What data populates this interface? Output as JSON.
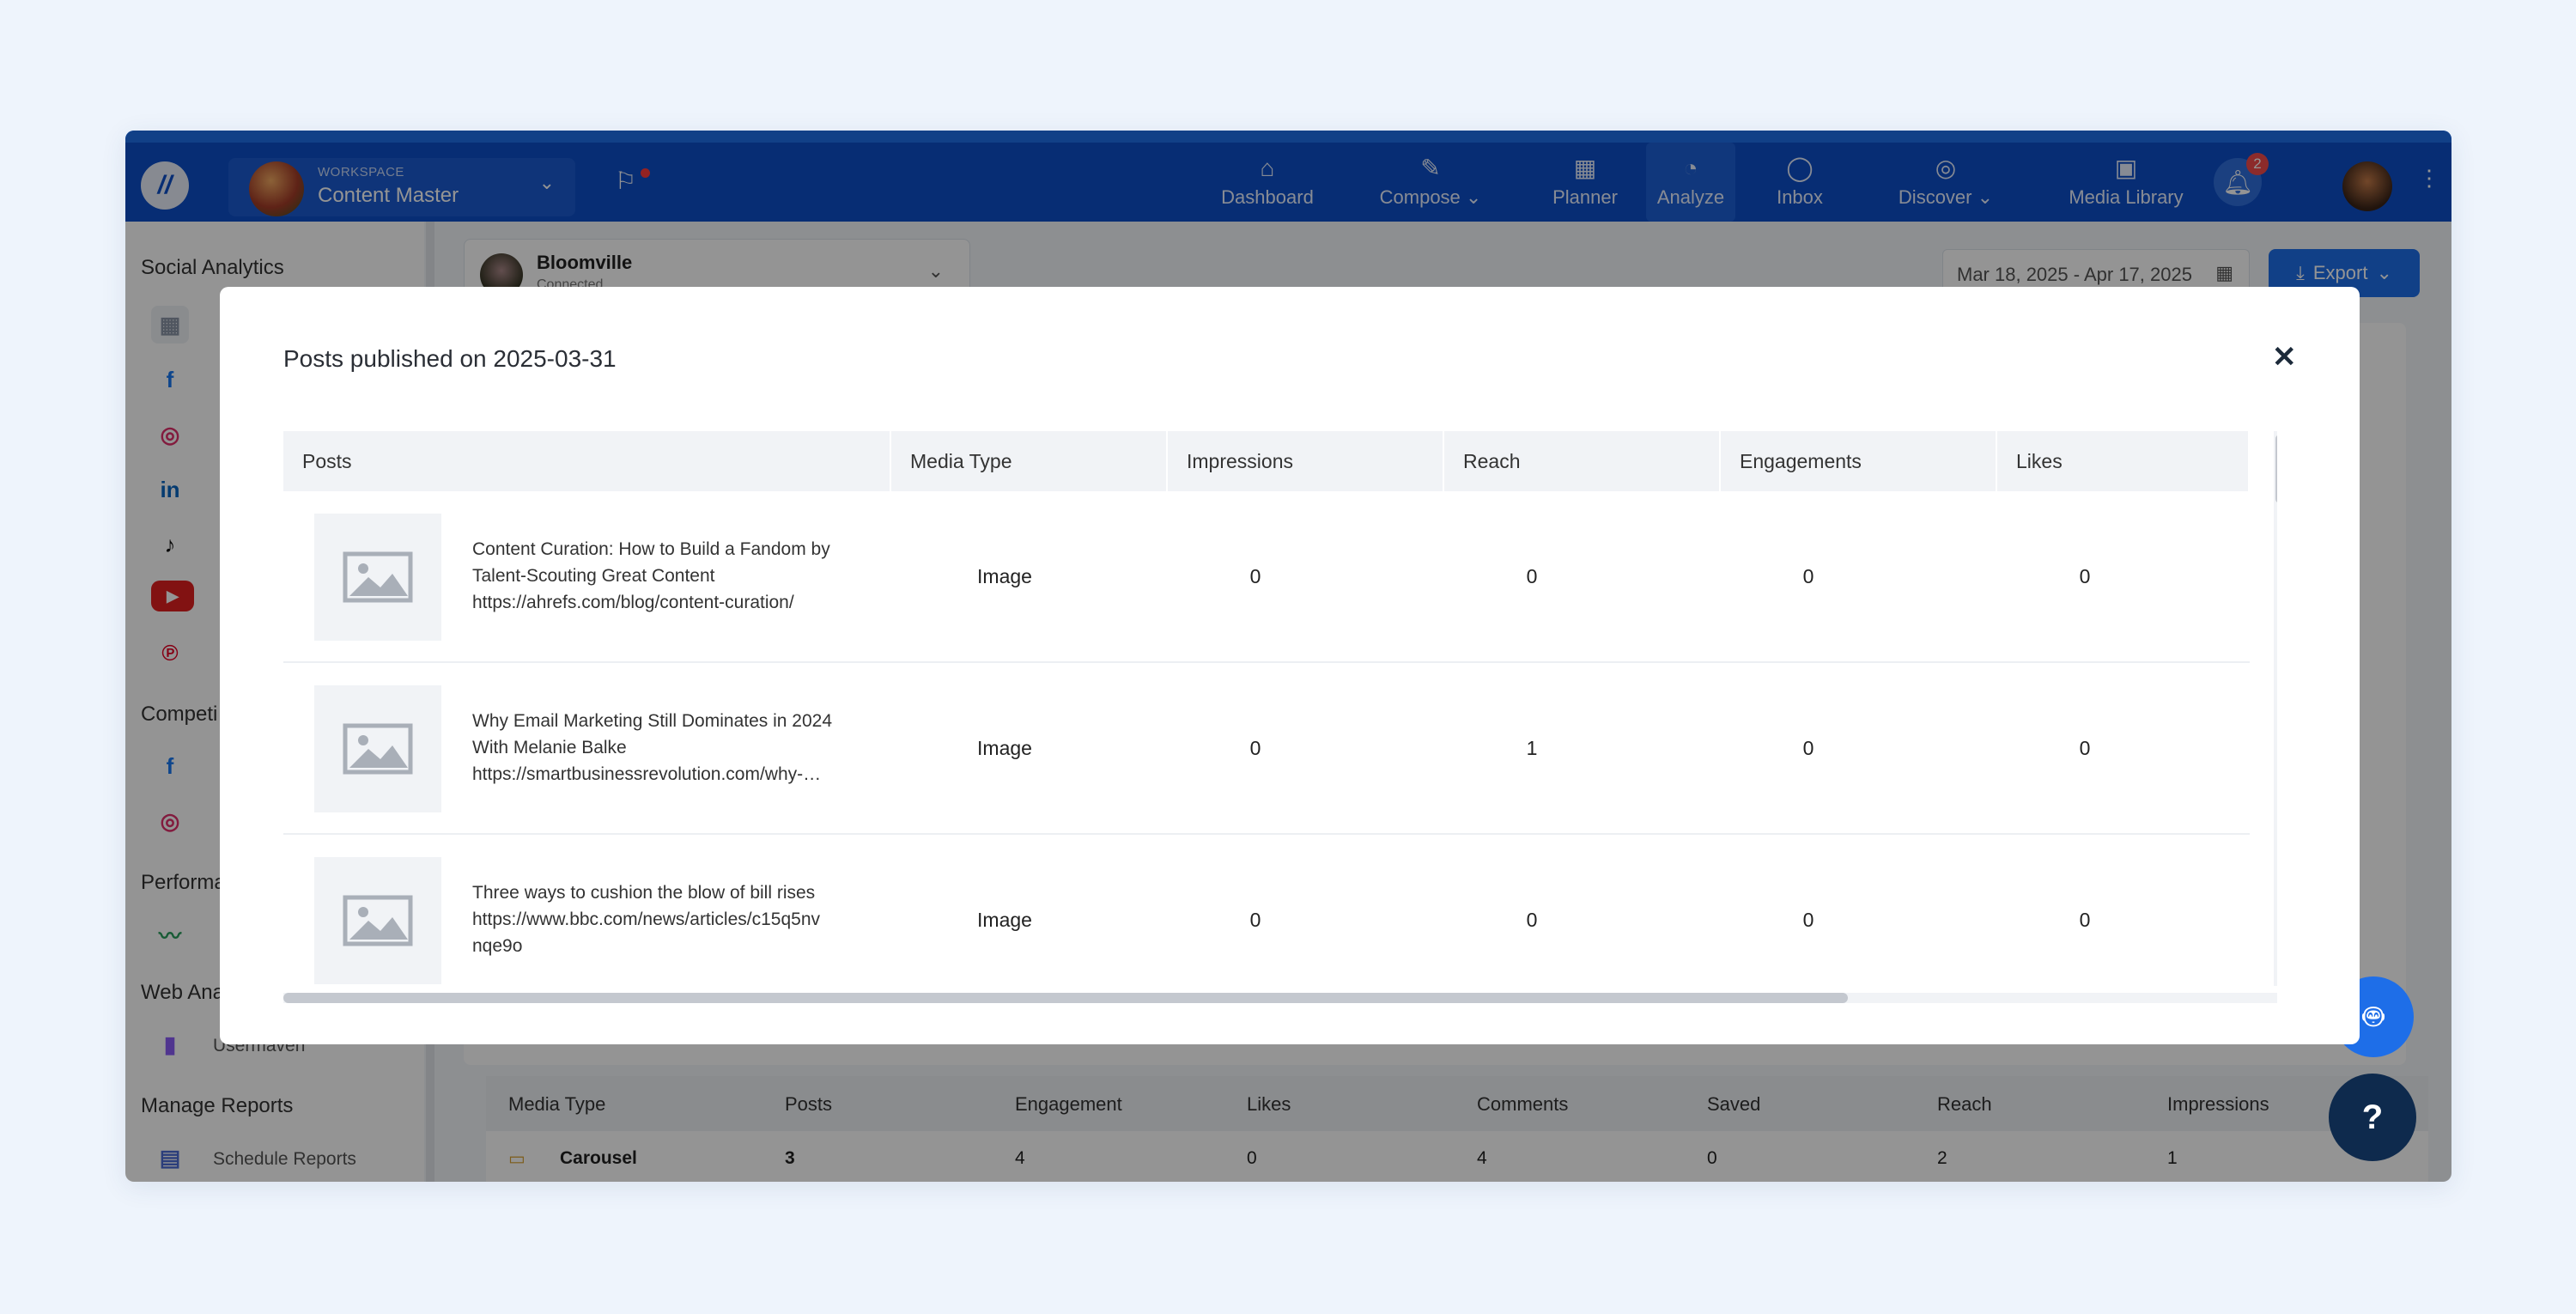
{
  "nav": {
    "workspace_label": "WORKSPACE",
    "workspace_name": "Content Master",
    "items": [
      {
        "label": "Dashboard",
        "icon": "home-icon"
      },
      {
        "label": "Compose",
        "icon": "pen-icon"
      },
      {
        "label": "Planner",
        "icon": "calendar-icon"
      },
      {
        "label": "Analyze",
        "icon": "pie-chart-icon"
      },
      {
        "label": "Inbox",
        "icon": "chat-icon"
      },
      {
        "label": "Discover",
        "icon": "compass-icon"
      },
      {
        "label": "Media Library",
        "icon": "images-icon"
      }
    ],
    "notification_count": "2"
  },
  "sidebar": {
    "heading_social": "Social Analytics",
    "heading_compet": "Competi",
    "heading_perf": "Performa",
    "heading_web": "Web Ana",
    "web_item": "Usermaven",
    "heading_reports": "Manage Reports",
    "reports_item": "Schedule Reports"
  },
  "main": {
    "account_name": "Bloomville",
    "account_status": "Connected",
    "date_range": "Mar 18, 2025 - Apr 17, 2025",
    "export_label": "Export",
    "bg_table": {
      "headers": [
        "Media Type",
        "Posts",
        "Engagement",
        "Likes",
        "Comments",
        "Saved",
        "Reach",
        "Impressions"
      ],
      "row": [
        "Carousel",
        "3",
        "4",
        "0",
        "4",
        "0",
        "2",
        "1"
      ]
    }
  },
  "modal": {
    "title": "Posts published on 2025-03-31",
    "columns": [
      "Posts",
      "Media Type",
      "Impressions",
      "Reach",
      "Engagements",
      "Likes"
    ],
    "rows": [
      {
        "line1": "Content Curation: How to Build a Fandom by",
        "line2": "Talent-Scouting Great Content",
        "line3": "https://ahrefs.com/blog/content-curation/",
        "media_type": "Image",
        "impressions": "0",
        "reach": "0",
        "engagements": "0",
        "likes": "0"
      },
      {
        "line1": "Why Email Marketing Still Dominates in 2024",
        "line2": "With Melanie Balke",
        "line3": "https://smartbusinessrevolution.com/why-…",
        "media_type": "Image",
        "impressions": "0",
        "reach": "1",
        "engagements": "0",
        "likes": "0"
      },
      {
        "line1": "Three ways to cushion the blow of bill rises",
        "line2": "https://www.bbc.com/news/articles/c15q5nv",
        "line3": "nqe9o",
        "media_type": "Image",
        "impressions": "0",
        "reach": "0",
        "engagements": "0",
        "likes": "0"
      }
    ]
  },
  "colors": {
    "primary": "#0d4fc8",
    "accent": "#1e6ee8",
    "badge": "#f24a4a"
  }
}
